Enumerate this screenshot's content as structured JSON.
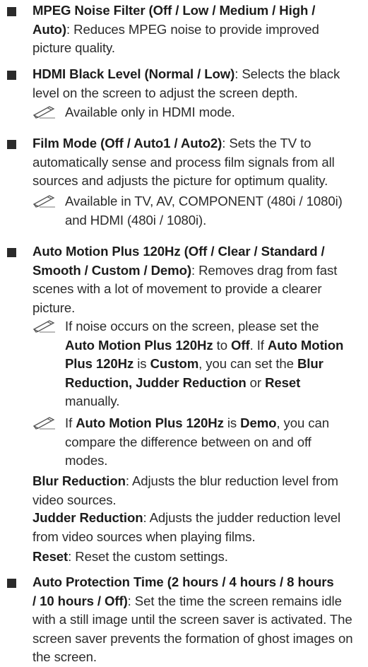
{
  "items": [
    {
      "lines": [
        [
          {
            "t": "MPEG Noise Filter (Off / Low / Medium / High /",
            "b": true
          }
        ],
        [
          {
            "t": "Auto)",
            "b": true
          },
          {
            "t": ": Reduces MPEG noise to provide improved"
          }
        ],
        [
          {
            "t": "picture quality."
          }
        ]
      ]
    },
    {
      "lines": [
        [
          {
            "t": "HDMI Black Level (Normal / Low)",
            "b": true
          },
          {
            "t": ": Selects the black"
          }
        ],
        [
          {
            "t": "level on the screen to adjust the screen depth."
          }
        ]
      ],
      "notes": [
        {
          "lines": [
            [
              {
                "t": "Available only in HDMI mode."
              }
            ]
          ]
        }
      ]
    },
    {
      "lines": [
        [
          {
            "t": "Film Mode (Off / Auto1 / Auto2)",
            "b": true
          },
          {
            "t": ": Sets the TV to"
          }
        ],
        [
          {
            "t": "automatically sense and process film signals from all"
          }
        ],
        [
          {
            "t": "sources and adjusts the picture for optimum quality."
          }
        ]
      ],
      "notes": [
        {
          "lines": [
            [
              {
                "t": "Available in TV, AV, COMPONENT (480i / 1080i)"
              }
            ],
            [
              {
                "t": "and HDMI (480i / 1080i)."
              }
            ]
          ]
        }
      ]
    },
    {
      "lines": [
        [
          {
            "t": "Auto Motion Plus 120Hz (Off / Clear / Standard /",
            "b": true
          }
        ],
        [
          {
            "t": "Smooth / Custom / Demo)",
            "b": true
          },
          {
            "t": ": Removes drag from fast"
          }
        ],
        [
          {
            "t": "scenes with a lot of movement to provide a clearer"
          }
        ],
        [
          {
            "t": "picture."
          }
        ]
      ],
      "notes": [
        {
          "lines": [
            [
              {
                "t": "If noise occurs on the screen, please set the"
              }
            ],
            [
              {
                "t": "Auto Motion Plus 120Hz",
                "b": true
              },
              {
                "t": " to "
              },
              {
                "t": "Off",
                "b": true
              },
              {
                "t": ". If "
              },
              {
                "t": "Auto Motion",
                "b": true
              }
            ],
            [
              {
                "t": "Plus 120Hz",
                "b": true
              },
              {
                "t": " is "
              },
              {
                "t": "Custom",
                "b": true
              },
              {
                "t": ", you can set the "
              },
              {
                "t": "Blur",
                "b": true
              }
            ],
            [
              {
                "t": "Reduction, Judder Reduction",
                "b": true
              },
              {
                "t": " or "
              },
              {
                "t": "Reset",
                "b": true
              }
            ],
            [
              {
                "t": "manually."
              }
            ]
          ]
        },
        {
          "lines": [
            [
              {
                "t": "If "
              },
              {
                "t": "Auto Motion Plus 120Hz",
                "b": true
              },
              {
                "t": " is "
              },
              {
                "t": "Demo",
                "b": true
              },
              {
                "t": ", you can"
              }
            ],
            [
              {
                "t": "compare the difference between on and off"
              }
            ],
            [
              {
                "t": "modes."
              }
            ]
          ]
        }
      ],
      "subs": [
        {
          "lines": [
            [
              {
                "t": "Blur Reduction",
                "b": true
              },
              {
                "t": ": Adjusts the blur reduction level from"
              }
            ],
            [
              {
                "t": "video sources."
              }
            ]
          ]
        },
        {
          "lines": [
            [
              {
                "t": "Judder Reduction",
                "b": true
              },
              {
                "t": ": Adjusts the judder reduction level"
              }
            ],
            [
              {
                "t": "from video sources when playing films."
              }
            ]
          ]
        },
        {
          "lines": [
            [
              {
                "t": "Reset",
                "b": true
              },
              {
                "t": ": Reset the custom settings."
              }
            ]
          ]
        }
      ]
    },
    {
      "lines": [
        [
          {
            "t": "Auto Protection Time (2 hours / 4 hours / 8 hours",
            "b": true
          }
        ],
        [
          {
            "t": "/ 10 hours / Off)",
            "b": true
          },
          {
            "t": ": Set the time the screen remains idle"
          }
        ],
        [
          {
            "t": "with a still image until the screen saver is activated. The"
          }
        ],
        [
          {
            "t": "screen saver prevents the formation of ghost images on"
          }
        ],
        [
          {
            "t": "the screen."
          }
        ]
      ]
    }
  ]
}
